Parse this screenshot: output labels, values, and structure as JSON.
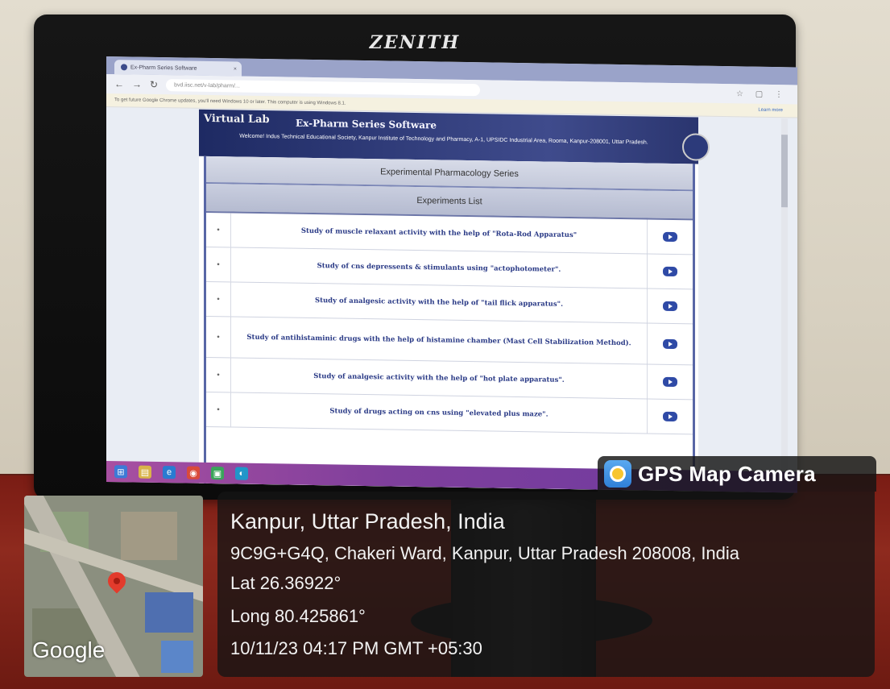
{
  "monitor": {
    "brand": "ZENITH"
  },
  "browser": {
    "tab_title": "Ex-Pharm Series Software",
    "address": "bvd.iisc.net/v-lab/pharm/...",
    "infobar_text": "To get future Google Chrome updates, you'll need Windows 10 or later. This computer is using Windows 8.1.",
    "infobar_link": "Learn more"
  },
  "site": {
    "title_a": "Virtual Lab",
    "title_b": "Ex-Pharm Series Software",
    "welcome": "Welcome!   Indus Technical Educational Society, Kanpur Institute of Technology and Pharmacy, A-1, UPSIDC Industrial Area, Rooma, Kanpur-208001, Uttar Pradesh.",
    "series_heading": "Experimental Pharmacology Series",
    "list_heading": "Experiments List",
    "experiments": [
      "Study of muscle relaxant activity with the help of \"Rota-Rod Apparatus\"",
      "Study of cns depressents & stimulants using \"actophotometer\".",
      "Study of analgesic activity with the help of \"tail flick apparatus\".",
      "Study of antihistaminic drugs with the help of histamine chamber (Mast Cell Stabilization Method).",
      "Study of analgesic activity with the help of \"hot plate apparatus\".",
      "Study of drugs acting on cns using \"elevated plus maze\"."
    ]
  },
  "gps": {
    "app_name": "GPS Map Camera",
    "city_line": "Kanpur, Uttar Pradesh, India",
    "address_line": "9C9G+G4Q, Chakeri Ward, Kanpur, Uttar Pradesh 208008, India",
    "lat": "Lat 26.36922°",
    "long": "Long 80.425861°",
    "datetime": "10/11/23 04:17 PM GMT +05:30",
    "map_attribution": "Google"
  }
}
